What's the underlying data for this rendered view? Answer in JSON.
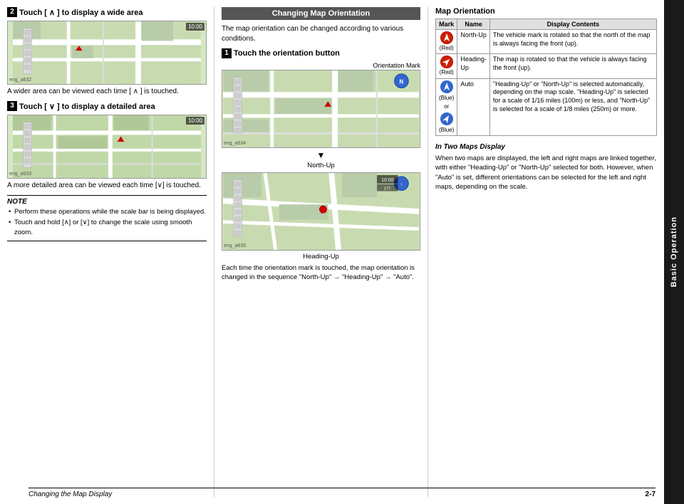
{
  "sidebar": {
    "label": "Basic Operation"
  },
  "left_col": {
    "step2": {
      "label": "2",
      "heading": "Touch [ ∧ ] to display a wide area"
    },
    "map1_id": "eng_a632",
    "map1_time": "10:00",
    "caption1": "A wider area can be viewed each time [ ∧ ] is touched.",
    "step3": {
      "label": "3",
      "heading": "Touch [ ∨ ] to display a detailed area"
    },
    "map2_id": "eng_a633",
    "map2_time": "10:00",
    "caption2": "A more detailed area can be viewed each time [∨] is touched.",
    "note": {
      "title": "NOTE",
      "items": [
        "Perform these operations while the scale bar is being displayed.",
        "Touch and hold [∧] or [∨] to change the scale using smooth zoom."
      ]
    }
  },
  "mid_col": {
    "header": "Changing Map Orientation",
    "intro": "The map orientation can be changed according to various conditions.",
    "step1": {
      "label": "1",
      "heading": "Touch the orientation button"
    },
    "orientation_mark_label": "Orientation Mark",
    "map1_id": "eng_a634",
    "north_up_label": "North-Up",
    "map2_id": "eng_a635",
    "map2_time": "10:00",
    "heading_up_label": "Heading-Up",
    "sequence_text": "Each time the orientation mark is touched, the map orientation is changed in the sequence \"North-Up\" → \"Heading-Up\" → \"Auto\"."
  },
  "right_col": {
    "map_orientation_title": "Map Orientation",
    "table": {
      "headers": [
        "Mark",
        "Name",
        "Display Contents"
      ],
      "rows": [
        {
          "mark_color": "red",
          "mark_label": "Red",
          "name": "North-Up",
          "content": "The vehicle mark is rotated so that the north of the map is always facing the front (up)."
        },
        {
          "mark_color": "red",
          "mark_label": "Red",
          "name": "Heading-\nUp",
          "content": "The map is rotated so that the vehicle is always facing the front (up)."
        },
        {
          "mark_color": "blue",
          "mark_label": "Blue or Blue",
          "name": "Auto",
          "content": "\"Heading-Up\" or \"North-Up\" is selected automatically, depending on the map scale. \"Heading-Up\" is selected for a scale of 1/16 miles (100m) or less, and \"North-Up\" is selected for a scale of 1/8 miles (250m) or more."
        }
      ]
    },
    "in_two_maps": {
      "title": "In Two Maps Display",
      "text": "When two maps are displayed, the left and right maps are linked together, with either \"Heading-Up\" or \"North-Up\" selected for both. However, when \"Auto\" is set, different orientations can be selected for the left and right maps, depending on the scale."
    }
  },
  "footer": {
    "left_text": "Changing the Map Display",
    "page": "2-7"
  }
}
